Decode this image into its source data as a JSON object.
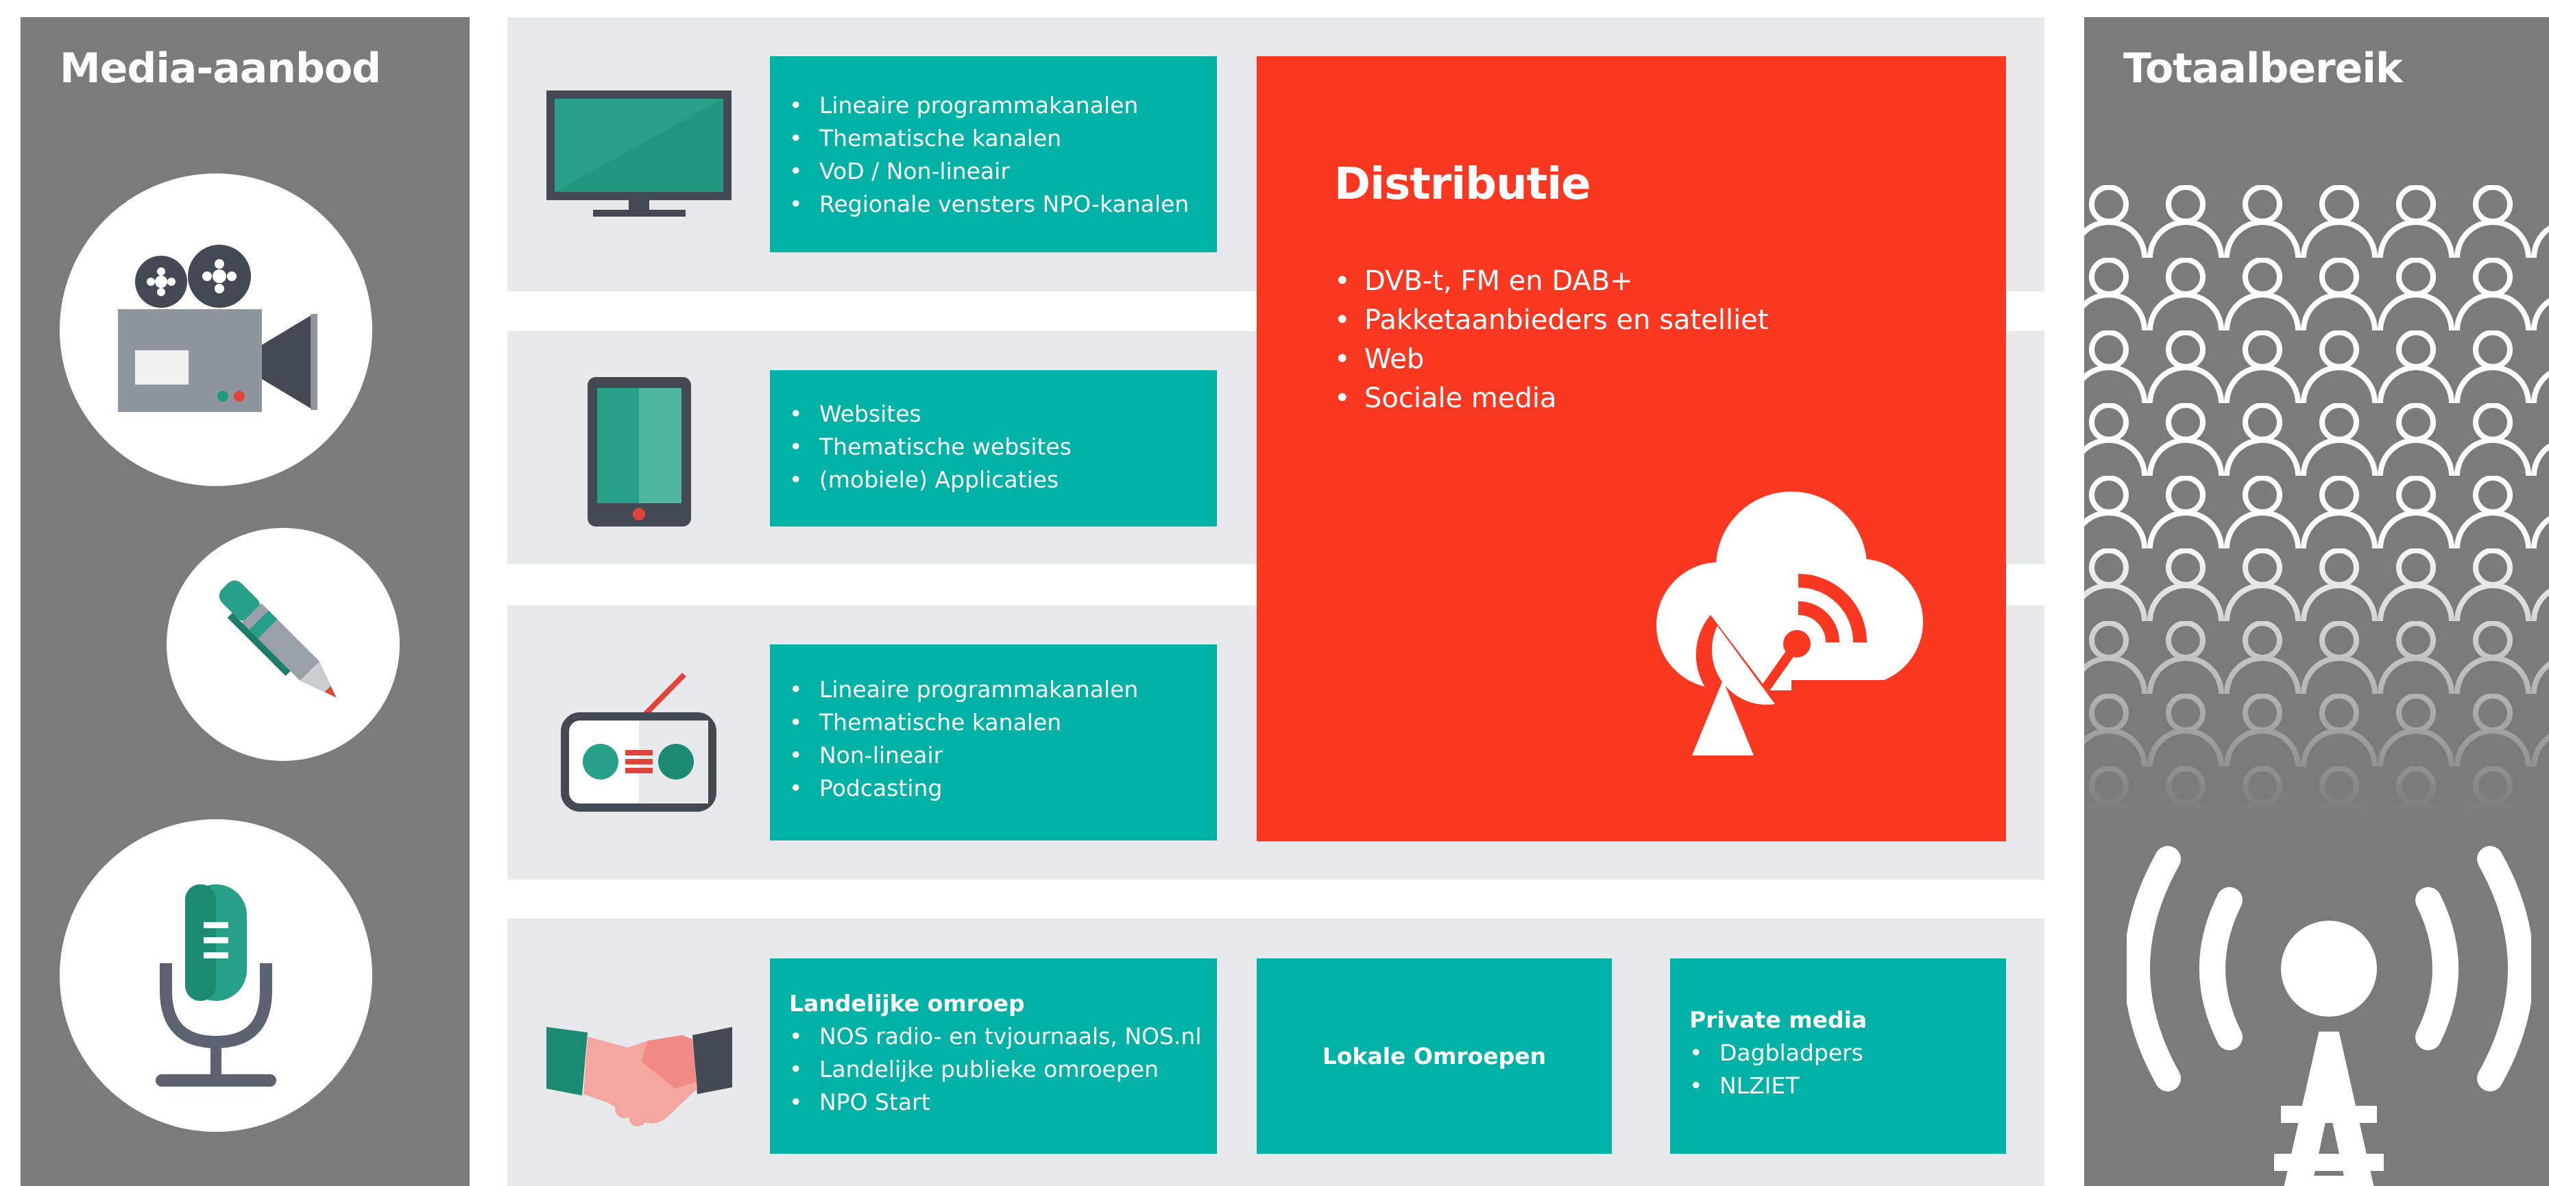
{
  "left_panel": {
    "title": "Media-aanbod"
  },
  "right_panel": {
    "title": "Totaalbereik"
  },
  "rows": {
    "tv": {
      "items": [
        "Lineaire programmakanalen",
        "Thematische kanalen",
        "VoD / Non-lineair",
        "Regionale vensters NPO-kanalen"
      ]
    },
    "mobile": {
      "items": [
        "Websites",
        "Thematische websites",
        "(mobiele) Applicaties"
      ]
    },
    "radio": {
      "items": [
        "Lineaire programmakanalen",
        "Thematische kanalen",
        "Non-lineair",
        "Podcasting"
      ]
    },
    "partners": {
      "landelijk": {
        "title": "Landelijke omroep",
        "items": [
          "NOS radio- en tvjournaals, NOS.nl",
          "Landelijke publieke omroepen",
          "NPO Start"
        ]
      },
      "lokaal": {
        "title": "Lokale Omroepen"
      },
      "private": {
        "title": "Private media",
        "items": [
          "Dagbladpers",
          "NLZIET"
        ]
      }
    }
  },
  "distribution": {
    "title": "Distributie",
    "items": [
      "DVB-t, FM en DAB+",
      "Pakketaanbieders en satelliet",
      "Web",
      "Sociale media"
    ]
  },
  "icons": [
    "film-camera-icon",
    "pen-icon",
    "microphone-icon",
    "tv-icon",
    "tablet-icon",
    "radio-icon",
    "handshake-icon",
    "cloud-satellite-icon",
    "audience-icon",
    "broadcast-tower-icon"
  ],
  "colors": {
    "teal": "#00b2a6",
    "red": "#fa3822",
    "grey_panel": "#7b7b7b",
    "band": "#e8e9ec"
  }
}
